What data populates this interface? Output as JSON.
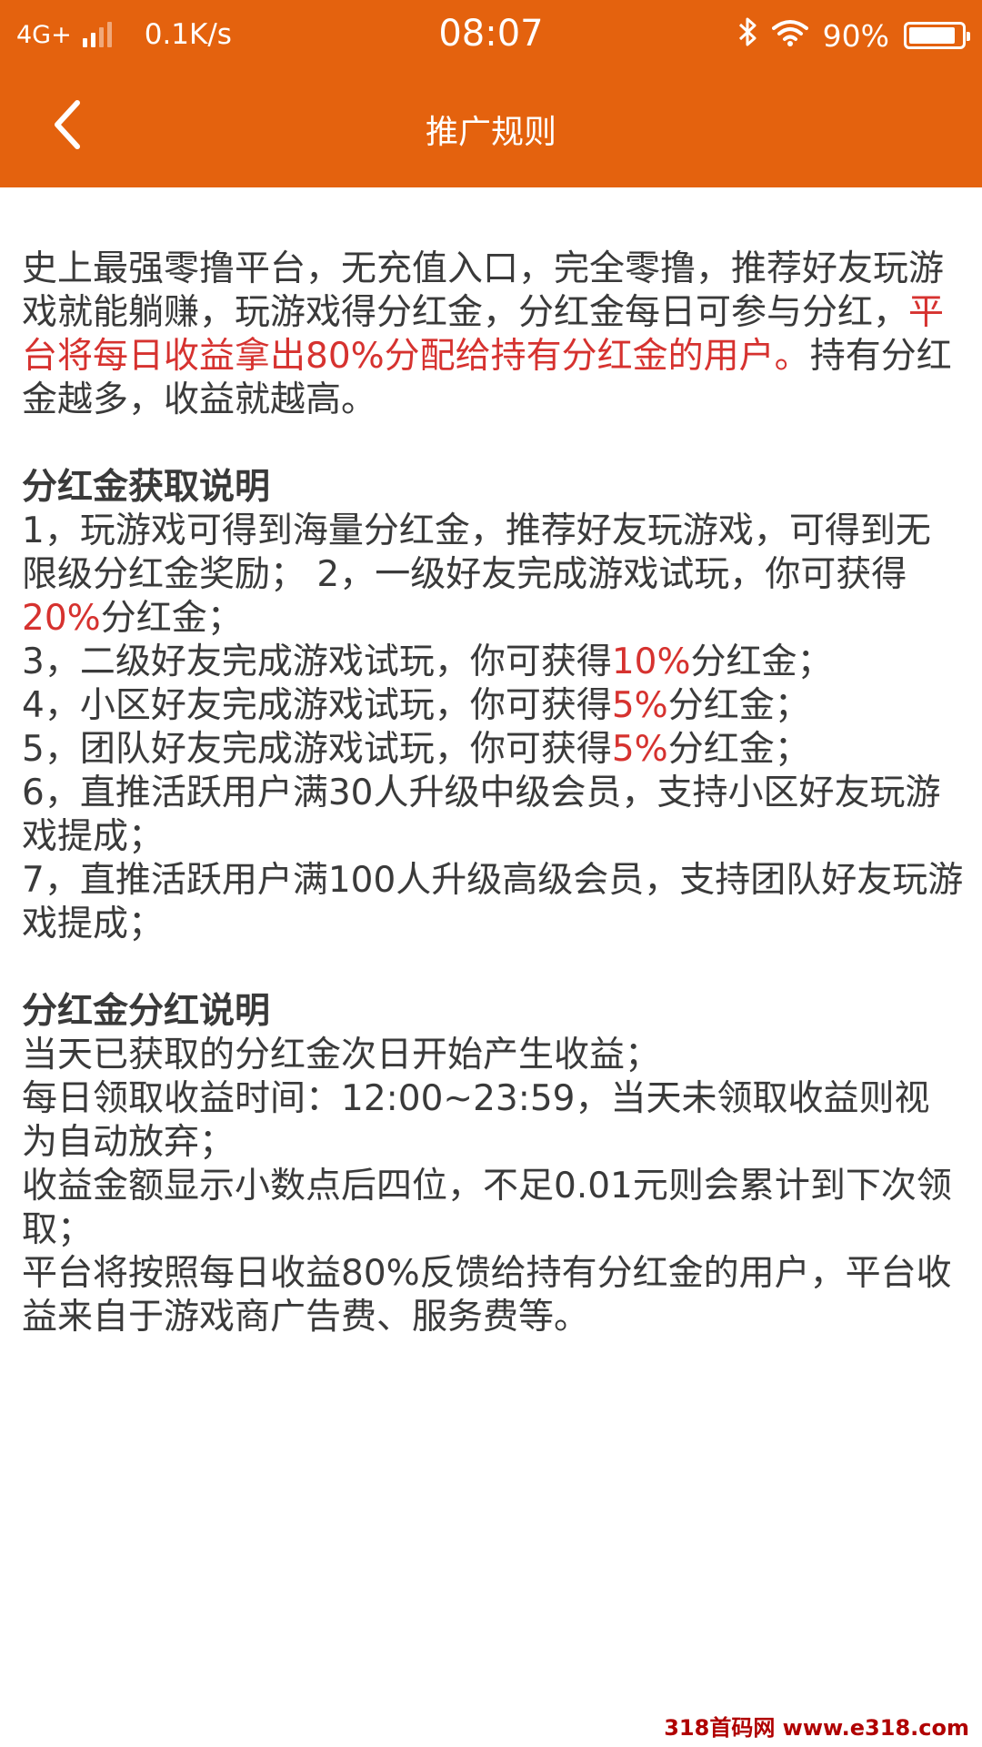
{
  "status_bar": {
    "network": "4G+",
    "speed": "0.1K/s",
    "time": "08:07",
    "battery": "90%",
    "battery_level": 0.9,
    "icons": [
      "signal-icon",
      "bluetooth-icon",
      "wifi-icon",
      "battery-icon"
    ]
  },
  "nav": {
    "title": "推广规则",
    "back_icon": "chevron-left-icon"
  },
  "content": {
    "intro_1": "史上最强零撸平台，无充值入口，完全零撸，推荐好友玩游戏就能躺赚，玩游戏得分红金，分红金每日可参与分红，",
    "intro_red": "平台将每日收益拿出80%分配给持有分红金的用户。",
    "intro_2": "持有分红金越多，收益就越高。",
    "section1_title": "分红金获取说明",
    "s1_l1": "1，玩游戏可得到海量分红金，推荐好友玩游戏，可得到无限级分红金奖励； 2，一级好友完成游戏试玩，你可获得",
    "s1_l1_red": "20%",
    "s1_l1_end": "分红金；",
    "s1_l3": "3，二级好友完成游戏试玩，你可获得",
    "s1_l3_red": "10%",
    "s1_l3_end": "分红金；",
    "s1_l4": "4，小区好友完成游戏试玩，你可获得",
    "s1_l4_red": "5%",
    "s1_l4_end": "分红金；",
    "s1_l5": "5，团队好友完成游戏试玩，你可获得",
    "s1_l5_red": "5%",
    "s1_l5_end": "分红金；",
    "s1_l6": "6，直推活跃用户满30人升级中级会员，支持小区好友玩游戏提成；",
    "s1_l7": "7，直推活跃用户满100人升级高级会员，支持团队好友玩游戏提成；",
    "section2_title": "分红金分红说明",
    "s2_l1": "当天已获取的分红金次日开始产生收益；",
    "s2_l2": "每日领取收益时间：12:00~23:59，当天未领取收益则视为自动放弃；",
    "s2_l3": "收益金额显示小数点后四位，不足0.01元则会累计到下次领取；",
    "s2_l4": "平台将按照每日收益80%反馈给持有分红金的用户，平台收益来自于游戏商广告费、服务费等。"
  },
  "watermark": "318首码网 www.e318.com",
  "colors": {
    "header_bg": "#e4620e",
    "highlight": "#d6322f",
    "text": "#3a3a3a"
  }
}
